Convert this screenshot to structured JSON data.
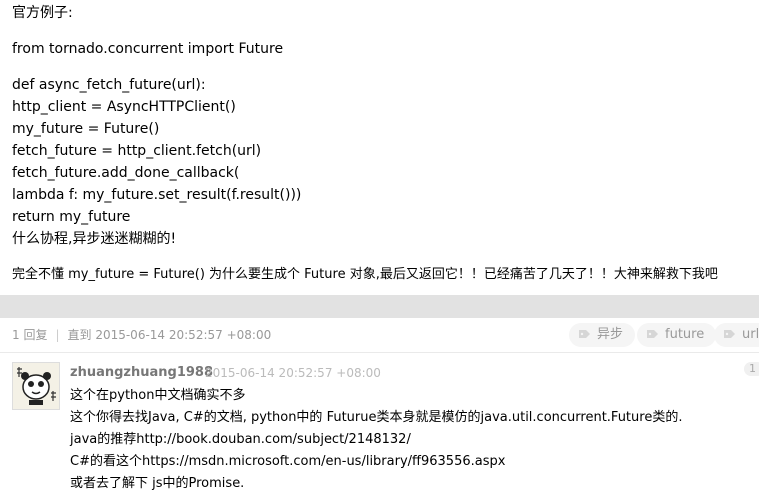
{
  "topic": {
    "lines": [
      "官方例子:",
      "from tornado.concurrent import Future",
      "def async_fetch_future(url):",
      "http_client = AsyncHTTPClient()",
      "my_future = Future()",
      "fetch_future = http_client.fetch(url)",
      "fetch_future.add_done_callback(",
      "lambda f: my_future.set_result(f.result()))",
      "return my_future",
      "什么协程,异步迷迷糊糊的!",
      "完全不懂 my_future = Future() 为什么要生成个 Future 对象,最后又返回它！！已经痛苦了几天了！！大神来解救下我吧"
    ]
  },
  "replies_header": {
    "count": "1 回复",
    "separator": "|",
    "until": "直到 2015-06-14 20:52:57 +08:00",
    "tags": [
      "异步",
      "future",
      "url"
    ]
  },
  "reply": {
    "author": "zhuangzhuang1988",
    "timestamp": "2015-06-14 20:52:57 +08:00",
    "floor": "1",
    "lines": [
      "这个在python中文档确实不多",
      "这个你得去找Java, C#的文档, python中的 Futurue类本身就是模仿的java.util.concurrent.Future类的.",
      "java的推荐http://book.douban.com/subject/2148132/",
      "C#的看这个https://msdn.microsoft.com/en-us/library/ff963556.aspx",
      "或者去了解下 js中的Promise."
    ]
  },
  "colors": {
    "meta": "#999999",
    "tag_bg": "#f5f5f5",
    "page_bg": "#e2e2e2"
  }
}
